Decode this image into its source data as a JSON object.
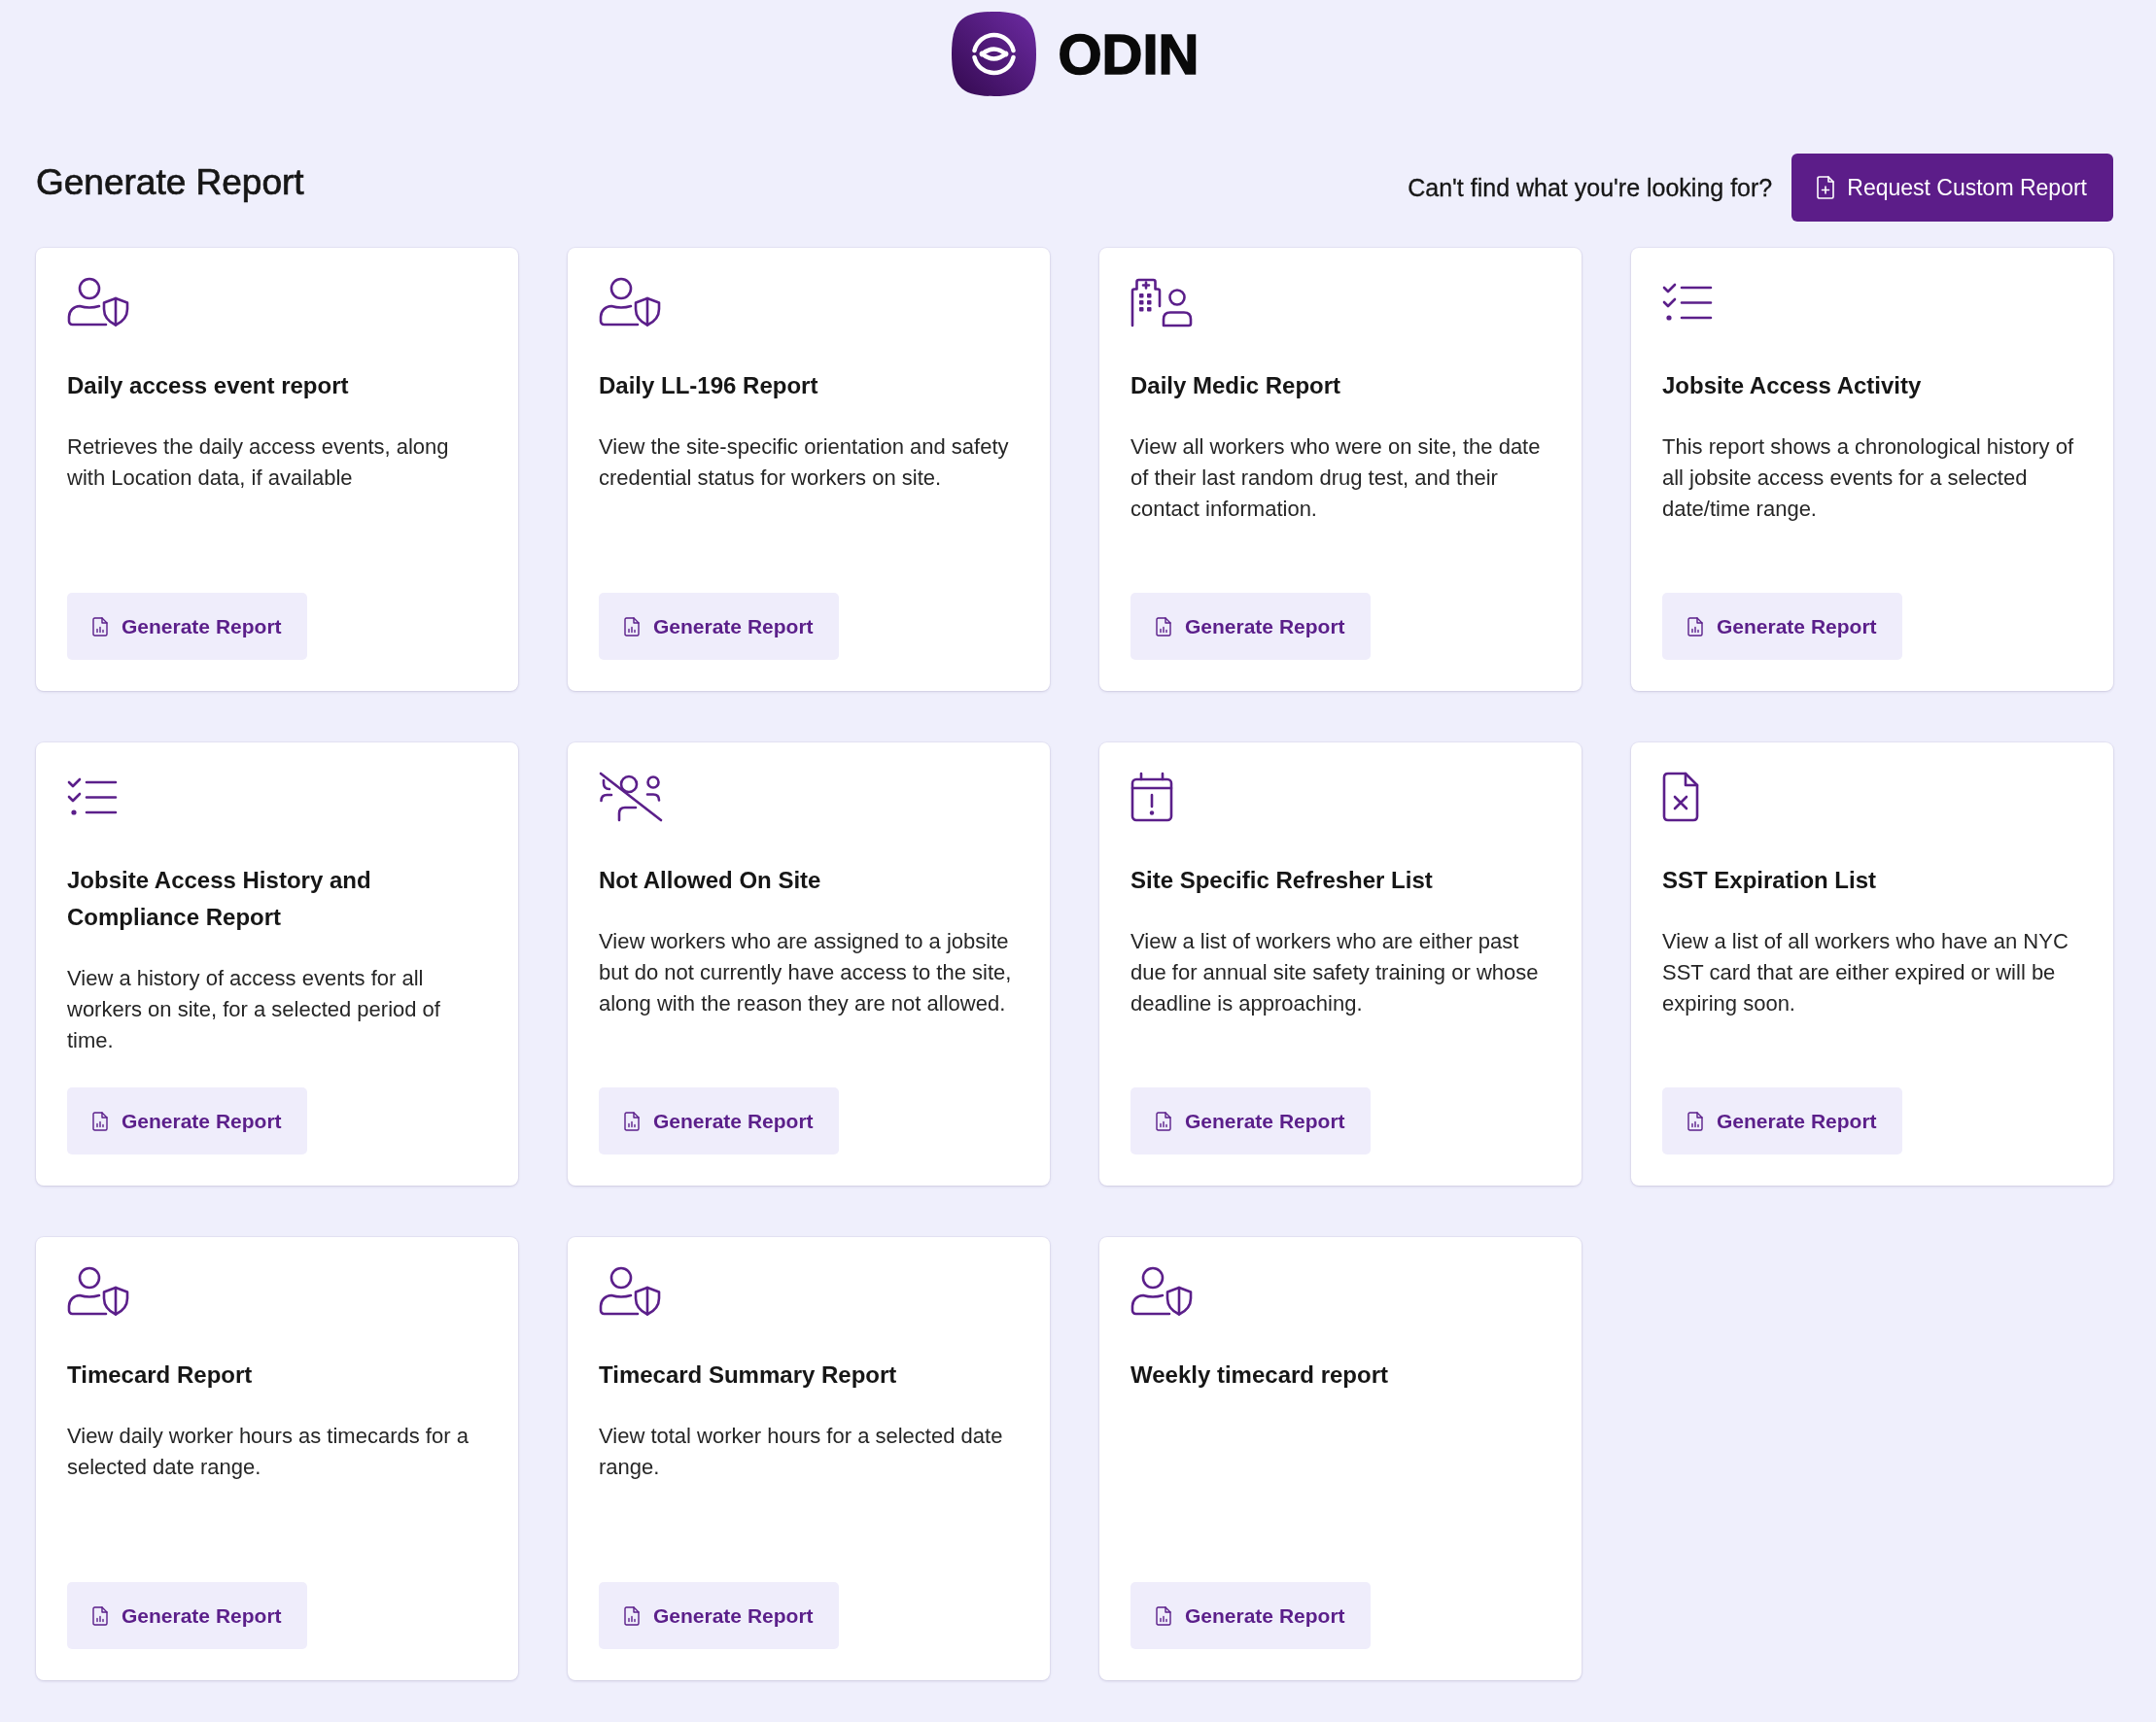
{
  "header": {
    "brand": "ODIN"
  },
  "page": {
    "title": "Generate Report",
    "help_text": "Can't find what you're looking for?",
    "request_button": "Request Custom Report"
  },
  "reports": [
    {
      "kind": "person-shield",
      "title": "Daily access event report",
      "description": "Retrieves the daily access events, along with Location data, if available",
      "button": "Generate Report"
    },
    {
      "kind": "person-shield",
      "title": "Daily LL-196 Report",
      "description": "View the site-specific orientation and safety credential status for workers on site.",
      "button": "Generate Report"
    },
    {
      "kind": "building-person",
      "title": "Daily Medic Report",
      "description": "View all workers who were on site, the date of their last random drug test, and their contact information.",
      "button": "Generate Report"
    },
    {
      "kind": "checklist",
      "title": "Jobsite Access Activity",
      "description": "This report shows a chronological history of all jobsite access events for a selected date/time range.",
      "button": "Generate Report"
    },
    {
      "kind": "checklist",
      "title": "Jobsite Access History and Compliance Report",
      "description": "View a history of access events for all workers on site, for a selected period of time.",
      "button": "Generate Report"
    },
    {
      "kind": "people-off",
      "title": "Not Allowed On Site",
      "description": "View workers who are assigned to a jobsite but do not currently have access to the site, along with the reason they are not allowed.",
      "button": "Generate Report"
    },
    {
      "kind": "calendar-alert",
      "title": "Site Specific Refresher List",
      "description": "View a list of workers who are either past due for annual site safety training or whose deadline is approaching.",
      "button": "Generate Report"
    },
    {
      "kind": "file-x",
      "title": "SST Expiration List",
      "description": "View a list of all workers who have an NYC SST card that are either expired or will be expiring soon.",
      "button": "Generate Report"
    },
    {
      "kind": "person-shield",
      "title": "Timecard Report",
      "description": "View daily worker hours as timecards for a selected date range.",
      "button": "Generate Report"
    },
    {
      "kind": "person-shield",
      "title": "Timecard Summary Report",
      "description": "View total worker hours for a selected date range.",
      "button": "Generate Report"
    },
    {
      "kind": "person-shield",
      "title": "Weekly timecard report",
      "button": "Generate Report"
    }
  ]
}
